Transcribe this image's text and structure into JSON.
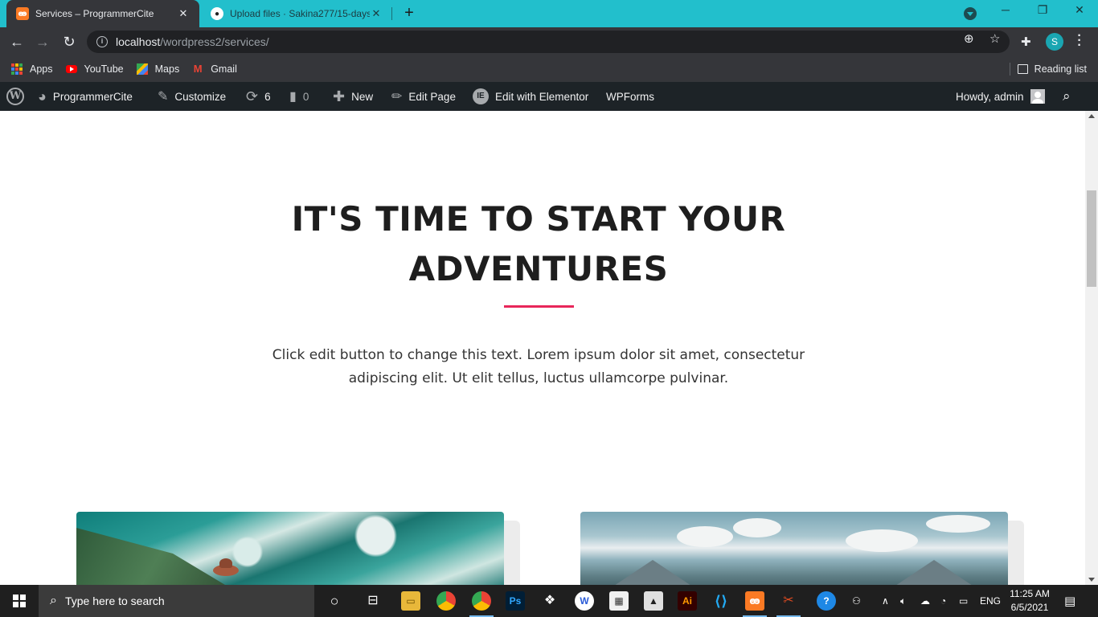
{
  "browser": {
    "tabs": [
      {
        "title": "Services – ProgrammerCite",
        "active": true
      },
      {
        "title": "Upload files · Sakina277/15-days",
        "active": false
      }
    ],
    "new_tab_label": "+",
    "url_host": "localhost",
    "url_path": "/wordpress2/services/",
    "profile_initial": "S",
    "bookmarks": [
      {
        "label": "Apps",
        "icon": "apps-grid-icon"
      },
      {
        "label": "YouTube",
        "icon": "youtube-icon"
      },
      {
        "label": "Maps",
        "icon": "maps-icon"
      },
      {
        "label": "Gmail",
        "icon": "gmail-icon"
      }
    ],
    "reading_list": "Reading list"
  },
  "adminbar": {
    "site_name": "ProgrammerCite",
    "customize": "Customize",
    "updates_count": "6",
    "comments_count": "0",
    "new": "New",
    "edit_page": "Edit Page",
    "edit_elementor": "Edit with Elementor",
    "wpforms": "WPForms",
    "howdy": "Howdy, admin"
  },
  "page": {
    "title": "IT'S TIME TO START YOUR ADVENTURES",
    "body": "Click edit button to change this text. Lorem ipsum dolor sit amet, consectetur adipiscing elit. Ut elit tellus, luctus ullamcorpe pulvinar.",
    "accent_color": "#e8265a"
  },
  "taskbar": {
    "search_placeholder": "Type here to search",
    "language": "ENG",
    "time": "11:25 AM",
    "date": "6/5/2021",
    "apps": [
      "task-view",
      "file-explorer",
      "chrome",
      "chrome-profile",
      "photoshop",
      "dropbox",
      "wps",
      "store",
      "inkscape",
      "illustrator",
      "vscode",
      "xampp",
      "git-tool",
      "help"
    ]
  }
}
